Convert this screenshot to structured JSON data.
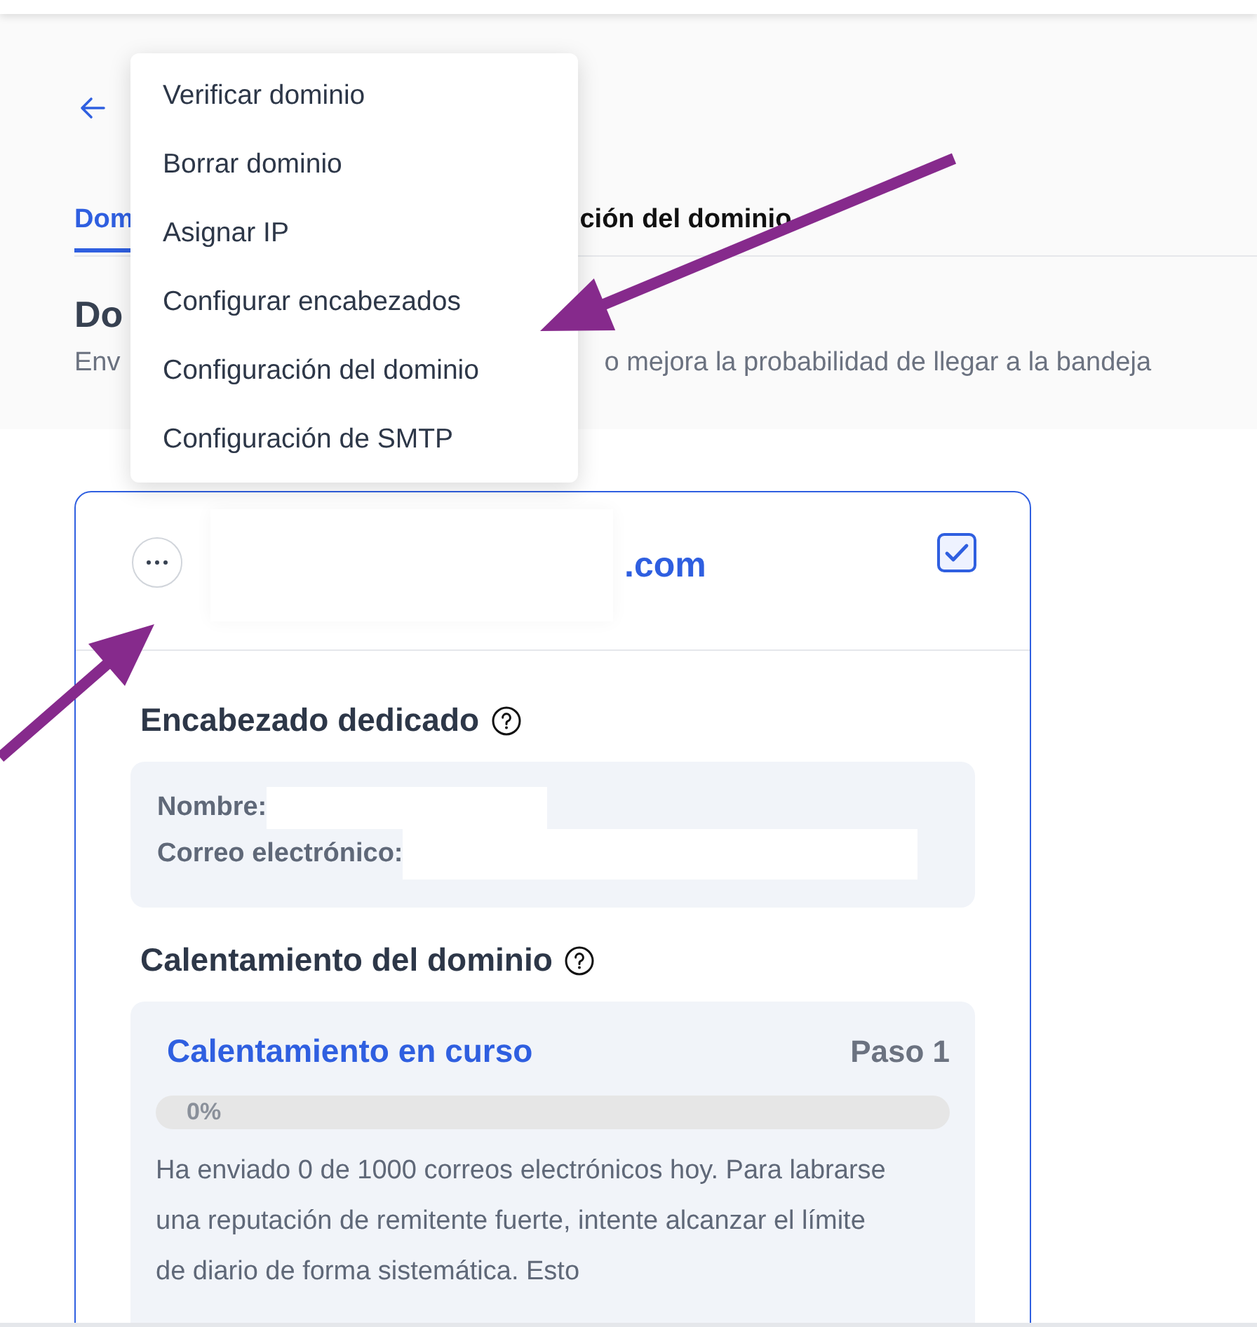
{
  "tabs": [
    {
      "label": "Dom",
      "selected": true
    },
    {
      "label": "ción del dominio",
      "selected": false
    }
  ],
  "page_heading": "Do",
  "subtitle_parts": [
    "Env",
    "o mejora la probabilidad de llegar a la bandeja"
  ],
  "menu": {
    "items": [
      "Verificar dominio",
      "Borrar dominio",
      "Asignar IP",
      "Configurar encabezados",
      "Configuración del dominio",
      "Configuración de SMTP"
    ]
  },
  "domain_card": {
    "domain_suffix": ".com",
    "checked": true,
    "sections": [
      {
        "kind": "sender",
        "title": "Encabezado dedicado",
        "fields": [
          {
            "label": "Nombre:"
          },
          {
            "label": "Correo electrónico:"
          }
        ]
      },
      {
        "kind": "warmup",
        "title": "Calentamiento del dominio",
        "status": "Calentamiento en curso",
        "step": "Paso 1",
        "level": 0,
        "progress_label": "0%",
        "description": "Ha enviado 0 de 1000 correos electrónicos hoy. Para labrarse una reputación de remitente fuerte, intente alcanzar el límite de diario de forma sistemática. Esto"
      }
    ]
  }
}
